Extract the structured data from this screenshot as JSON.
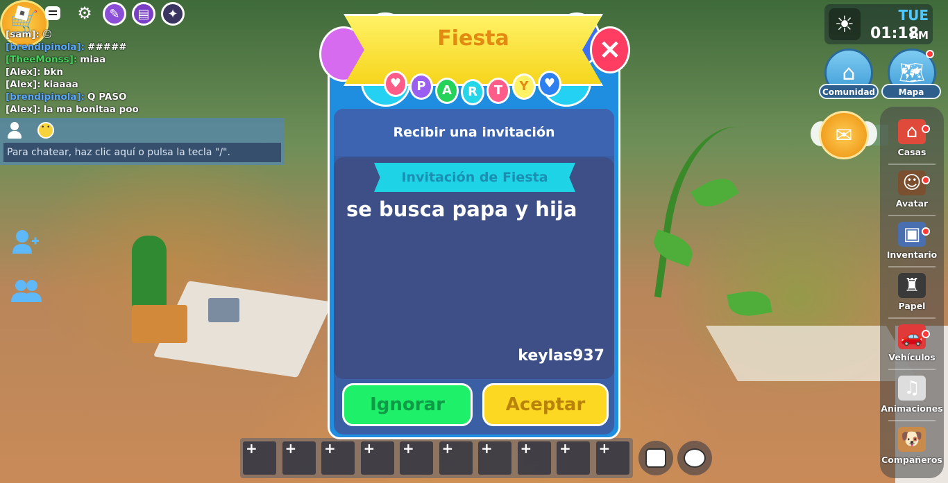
{
  "toolbar": {
    "icons": [
      "roblox-menu-icon",
      "chat-icon",
      "settings-gear-icon",
      "notes-icon",
      "news-icon",
      "party-lights-icon"
    ]
  },
  "chat": {
    "messages": [
      {
        "name": "[sam]:",
        "name_color": "#ffffff",
        "text": "😑"
      },
      {
        "name": "[brendipinola]:",
        "name_color": "#5aa8ff",
        "text": "#####"
      },
      {
        "name": "[TheeMonss]:",
        "name_color": "#45d45e",
        "text": "miaa"
      },
      {
        "name": "[Alex]:",
        "name_color": "#ffffff",
        "text": "bkn"
      },
      {
        "name": "[Alex]:",
        "name_color": "#ffffff",
        "text": "kiaaaa"
      },
      {
        "name": "[brendipinola]:",
        "name_color": "#5aa8ff",
        "text": "Q PASO"
      },
      {
        "name": "[Alex]:",
        "name_color": "#ffffff",
        "text": "la ma bonitaa poo"
      }
    ],
    "input_placeholder": "Para chatear, haz clic aquí o pulsa la tecla \"/\"."
  },
  "clock": {
    "day": "TUE",
    "time": "01:18",
    "ampm": "AM"
  },
  "top_right": {
    "community_label": "Comunidad",
    "map_label": "Mapa"
  },
  "sidebar": {
    "items": [
      {
        "label": "Casas",
        "icon": "house-icon",
        "badge": true
      },
      {
        "label": "Avatar",
        "icon": "avatar-icon",
        "badge": true
      },
      {
        "label": "Inventario",
        "icon": "backpack-icon",
        "badge": true
      },
      {
        "label": "Papel",
        "icon": "role-suit-icon",
        "badge": false
      },
      {
        "label": "Vehículos",
        "icon": "car-icon",
        "badge": true
      },
      {
        "label": "Animaciones",
        "icon": "dance-icon",
        "badge": false
      },
      {
        "label": "Compañeros",
        "icon": "pet-dog-icon",
        "badge": false
      }
    ]
  },
  "hotbar": {
    "slots": [
      "+",
      "+",
      "+",
      "+",
      "+",
      "+",
      "+",
      "+",
      "+",
      "+"
    ]
  },
  "dialog": {
    "title": "Fiesta",
    "banner_letters": [
      "P",
      "A",
      "R",
      "T",
      "Y"
    ],
    "subtitle": "Recibir una invitación",
    "ribbon": "Invitación de Fiesta",
    "message": "se busca papa y hija",
    "sender": "keylas937",
    "ignore_label": "Ignorar",
    "accept_label": "Aceptar",
    "close_label": "×"
  },
  "colors": {
    "dialog_blue": "#1f8ee0",
    "panel": "#3a5fa5",
    "accept": "#fcd823",
    "ignore": "#1ff06a",
    "close": "#ff3c61"
  }
}
